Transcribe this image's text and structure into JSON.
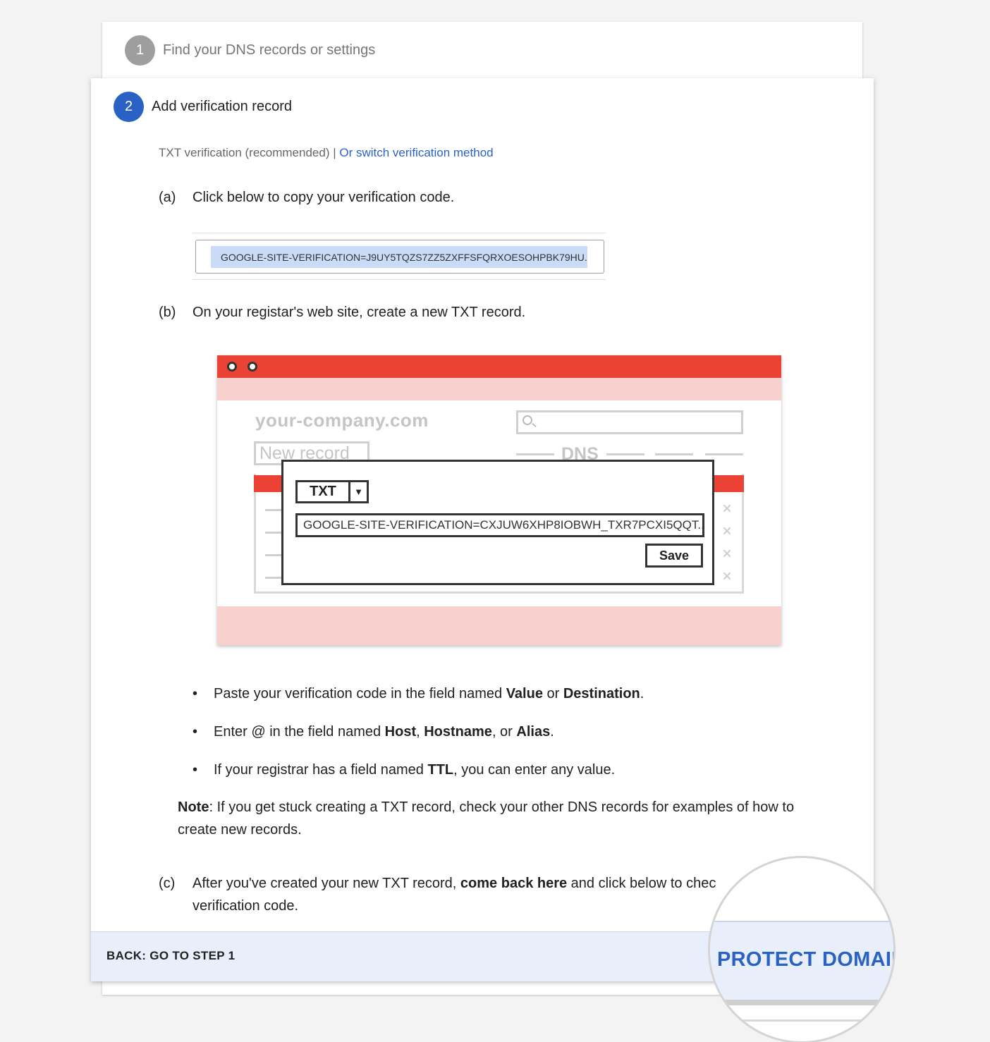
{
  "step1": {
    "number": "1",
    "label": "Find your DNS records or settings"
  },
  "step2": {
    "number": "2",
    "label": "Add verification record",
    "method_text": "TXT verification (recommended) | ",
    "method_link": "Or switch verification method",
    "a": {
      "letter": "(a)",
      "text": "Click below to copy your verification code.",
      "code": "GOOGLE-SITE-VERIFICATION=J9UY5TQZS7ZZ5ZXFFSFQRXOESOHPBK79HU..."
    },
    "b": {
      "letter": "(b)",
      "text": "On your registar's web site, create a new TXT record."
    },
    "illustration": {
      "domain": "your-company.com",
      "new_record": "New record",
      "dns": "DNS",
      "record_type": "TXT",
      "record_value": "GOOGLE-SITE-VERIFICATION=CXJUW6XHP8IOBWH_TXR7PCXI5QQT...",
      "save": "Save",
      "close_glyph": "×"
    },
    "bullets": {
      "one": {
        "pre": "Paste your verification code in the field named ",
        "b1": "Value",
        "mid": " or ",
        "b2": "Destination",
        "post": "."
      },
      "two": {
        "pre": "Enter @ in the field named ",
        "b1": "Host",
        "c1": ", ",
        "b2": "Hostname",
        "c2": ", or ",
        "b3": "Alias",
        "post": "."
      },
      "three": {
        "pre": "If your registrar has a field named ",
        "b1": "TTL",
        "post": ", you can enter any value."
      }
    },
    "note": {
      "label": "Note",
      "text": ": If you get stuck creating a TXT record, check your other DNS records for examples of how to create new records."
    },
    "c": {
      "letter": "(c)",
      "pre": "After you've created your new TXT record, ",
      "bold": "come back here",
      "post": " and click below to chec",
      "line2": "verification code."
    }
  },
  "footer": {
    "back_label": "BACK: GO TO STEP 1",
    "protect_label": "PROTECT DOMAIN"
  },
  "colors": {
    "accent_blue": "#2962c4",
    "brand_red": "#ea4335",
    "footer_bg": "#e8effb"
  }
}
